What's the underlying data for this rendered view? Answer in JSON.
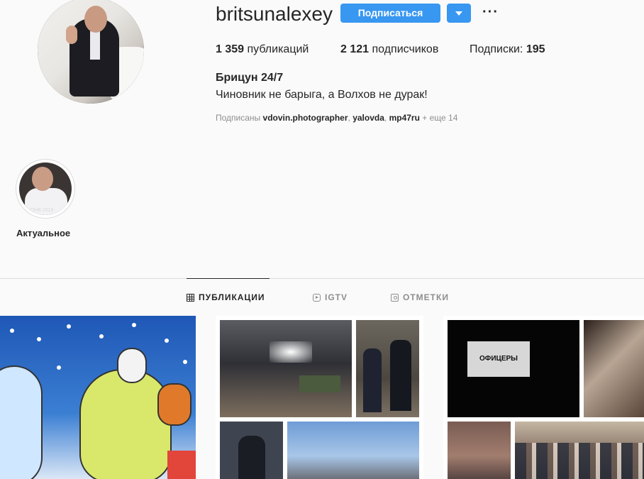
{
  "profile": {
    "username": "britsunalexey",
    "follow_label": "Подписаться",
    "stats": {
      "posts_count": "1 359",
      "posts_label": "публикаций",
      "followers_count": "2 121",
      "followers_label": "подписчиков",
      "following_label": "Подписки:",
      "following_count": "195"
    },
    "full_name": "Брицун 24/7",
    "bio": "Чиновник не барыга, а Волхов не дурак!",
    "followed_by": {
      "prefix": "Подписаны",
      "users": [
        "vdovin.photographer",
        "yalovda",
        "mp47ru"
      ],
      "more": "+ еще 14"
    }
  },
  "highlights": [
    {
      "label": "Актуальное",
      "image_caption": "ПНВ 2019"
    }
  ],
  "tabs": [
    {
      "label": "ПУБЛИКАЦИИ",
      "icon": "grid-icon",
      "active": true
    },
    {
      "label": "IGTV",
      "icon": "igtv-icon",
      "active": false
    },
    {
      "label": "ОТМЕТКИ",
      "icon": "tagged-icon",
      "active": false
    }
  ],
  "posts": [
    {
      "kind": "cartoon-illustration"
    },
    {
      "kind": "photo-collage-depot"
    },
    {
      "kind": "photo-collage-cinema",
      "screen_text": "ОФИЦЕРЫ"
    }
  ],
  "colors": {
    "accent": "#3897f0",
    "text": "#262626",
    "muted": "#8e8e8e",
    "background": "#fafafa",
    "divider": "#dbdbdb"
  }
}
